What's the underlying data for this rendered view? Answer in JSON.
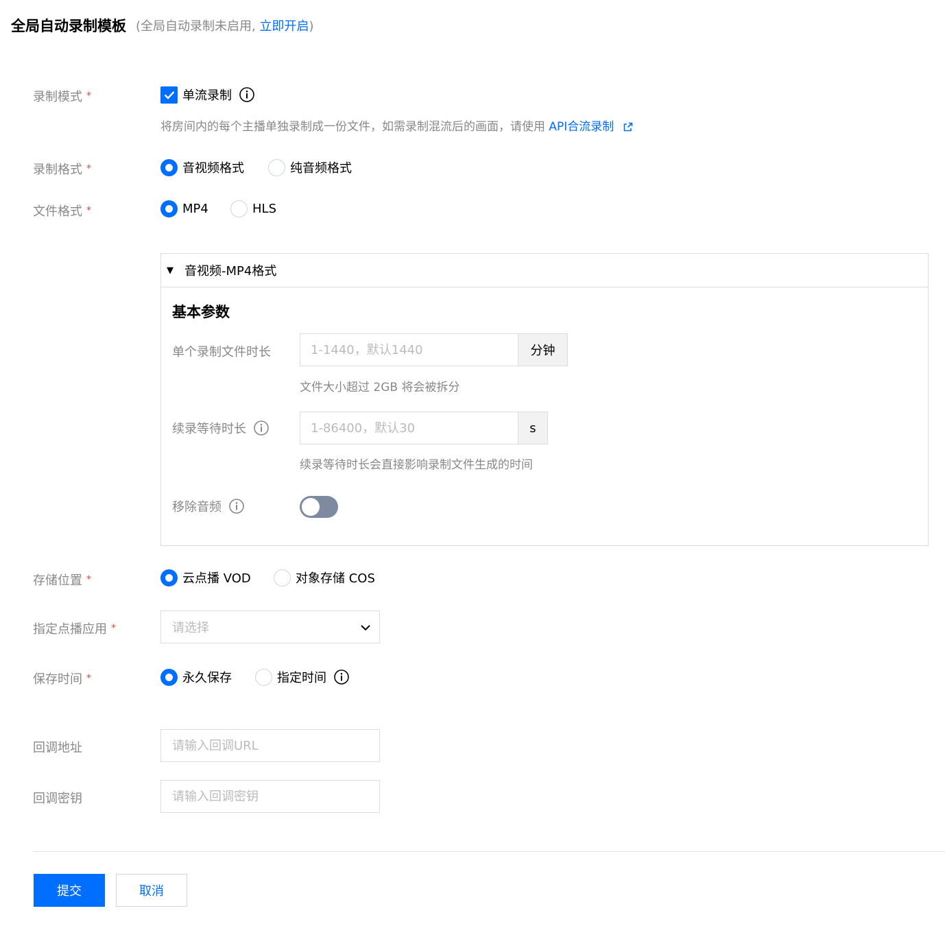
{
  "header": {
    "title": "全局自动录制模板",
    "status_prefix": "(全局自动录制未启用, ",
    "enable_link": "立即开启",
    "status_suffix": ")"
  },
  "required_mark": "*",
  "record_mode": {
    "label": "录制模式",
    "option": {
      "label": "单流录制",
      "checked": true
    },
    "hint": "将房间内的每个主播单独录制成一份文件，如需录制混流后的画面，请使用 ",
    "hint_link": "API合流录制"
  },
  "record_format": {
    "label": "录制格式",
    "options": [
      {
        "label": "音视频格式",
        "selected": true
      },
      {
        "label": "纯音频格式",
        "selected": false
      }
    ]
  },
  "file_format": {
    "label": "文件格式",
    "options": [
      {
        "label": "MP4",
        "selected": true
      },
      {
        "label": "HLS",
        "selected": false
      }
    ]
  },
  "panel": {
    "title": "音视频-MP4格式",
    "section_title": "基本参数",
    "file_duration": {
      "label": "单个录制文件时长",
      "placeholder": "1-1440，默认1440",
      "unit": "分钟",
      "hint": "文件大小超过 2GB 将会被拆分"
    },
    "wait_duration": {
      "label": "续录等待时长",
      "placeholder": "1-86400，默认30",
      "unit": "s",
      "hint": "续录等待时长会直接影响录制文件生成的时间"
    },
    "remove_audio": {
      "label": "移除音频",
      "enabled": false
    }
  },
  "storage": {
    "label": "存储位置",
    "options": [
      {
        "label": "云点播 VOD",
        "selected": true
      },
      {
        "label": "对象存储 COS",
        "selected": false
      }
    ]
  },
  "vod_app": {
    "label": "指定点播应用",
    "placeholder": "请选择"
  },
  "retention": {
    "label": "保存时间",
    "options": [
      {
        "label": "永久保存",
        "selected": true
      },
      {
        "label": "指定时间",
        "selected": false
      }
    ]
  },
  "callback_url": {
    "label": "回调地址",
    "placeholder": "请输入回调URL"
  },
  "callback_key": {
    "label": "回调密钥",
    "placeholder": "请输入回调密钥"
  },
  "buttons": {
    "submit": "提交",
    "cancel": "取消"
  },
  "colors": {
    "primary": "#006eff",
    "required": "#e54545",
    "label": "#888888",
    "toggle_off": "#7e8a9f"
  }
}
